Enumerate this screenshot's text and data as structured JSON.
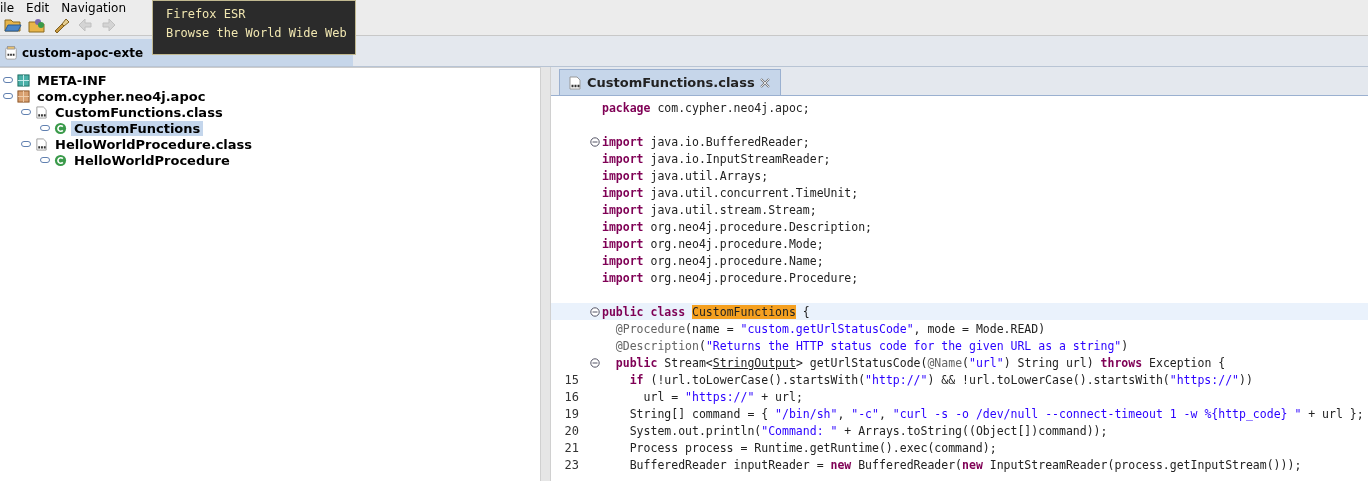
{
  "menu": [
    "ile",
    "Edit",
    "Navigation"
  ],
  "toolbar": [
    {
      "kind": "open"
    },
    {
      "kind": "open-type"
    },
    {
      "kind": "search"
    },
    {
      "kind": "back",
      "disabled": true
    },
    {
      "kind": "forward",
      "disabled": true
    }
  ],
  "tooltip": {
    "title": "Firefox ESR",
    "text": "Browse the World Wide Web"
  },
  "file_tab": {
    "label": "custom-apoc-exte"
  },
  "tree": [
    {
      "label": "META-INF",
      "kind": "folder",
      "selected": false
    },
    {
      "label": "com.cypher.neo4j.apoc",
      "kind": "package",
      "selected": false,
      "children": [
        {
          "label": "CustomFunctions.class",
          "kind": "classfile",
          "selected": false,
          "children": [
            {
              "label": "CustomFunctions",
              "kind": "class",
              "selected": true
            }
          ]
        },
        {
          "label": "HelloWorldProcedure.class",
          "kind": "classfile",
          "selected": false,
          "children": [
            {
              "label": "HelloWorldProcedure",
              "kind": "class",
              "selected": false
            }
          ]
        }
      ]
    }
  ],
  "editor_tab": {
    "label": "CustomFunctions.class",
    "selected": true
  },
  "code": [
    {
      "fold": false,
      "current": false,
      "tokens": [
        {
          "kind": "keyword",
          "text": "package"
        },
        {
          "kind": "plain",
          "text": " com.cypher.neo4j.apoc;"
        }
      ]
    },
    {
      "fold": false,
      "current": false
    },
    {
      "fold": true,
      "current": false,
      "tokens": [
        {
          "kind": "keyword",
          "text": "import"
        },
        {
          "kind": "plain",
          "text": " java.io.BufferedReader;"
        }
      ]
    },
    {
      "fold": false,
      "current": false,
      "tokens": [
        {
          "kind": "keyword",
          "text": "import"
        },
        {
          "kind": "plain",
          "text": " java.io.InputStreamReader;"
        }
      ]
    },
    {
      "fold": false,
      "current": false,
      "tokens": [
        {
          "kind": "keyword",
          "text": "import"
        },
        {
          "kind": "plain",
          "text": " java.util.Arrays;"
        }
      ]
    },
    {
      "fold": false,
      "current": false,
      "tokens": [
        {
          "kind": "keyword",
          "text": "import"
        },
        {
          "kind": "plain",
          "text": " java.util.concurrent.TimeUnit;"
        }
      ]
    },
    {
      "fold": false,
      "current": false,
      "tokens": [
        {
          "kind": "keyword",
          "text": "import"
        },
        {
          "kind": "plain",
          "text": " java.util.stream.Stream;"
        }
      ]
    },
    {
      "fold": false,
      "current": false,
      "tokens": [
        {
          "kind": "keyword",
          "text": "import"
        },
        {
          "kind": "plain",
          "text": " org.neo4j.procedure.Description;"
        }
      ]
    },
    {
      "fold": false,
      "current": false,
      "tokens": [
        {
          "kind": "keyword",
          "text": "import"
        },
        {
          "kind": "plain",
          "text": " org.neo4j.procedure.Mode;"
        }
      ]
    },
    {
      "fold": false,
      "current": false,
      "tokens": [
        {
          "kind": "keyword",
          "text": "import"
        },
        {
          "kind": "plain",
          "text": " org.neo4j.procedure.Name;"
        }
      ]
    },
    {
      "fold": false,
      "current": false,
      "tokens": [
        {
          "kind": "keyword",
          "text": "import"
        },
        {
          "kind": "plain",
          "text": " org.neo4j.procedure.Procedure;"
        }
      ]
    },
    {
      "fold": false,
      "current": false
    },
    {
      "fold": true,
      "current": true,
      "tokens": [
        {
          "kind": "keyword",
          "text": "public class "
        },
        {
          "kind": "highlight",
          "text": "CustomFunctions"
        },
        {
          "kind": "plain",
          "text": " {"
        }
      ]
    },
    {
      "fold": false,
      "current": false,
      "tokens": [
        {
          "kind": "annotation",
          "text": "  @Procedure"
        },
        {
          "kind": "plain",
          "text": "(name = "
        },
        {
          "kind": "string",
          "text": "\"custom.getUrlStatusCode\""
        },
        {
          "kind": "plain",
          "text": ", mode = Mode.READ)"
        }
      ]
    },
    {
      "fold": false,
      "current": false,
      "tokens": [
        {
          "kind": "annotation",
          "text": "  @Description"
        },
        {
          "kind": "plain",
          "text": "("
        },
        {
          "kind": "string",
          "text": "\"Returns the HTTP status code for the given URL as a string\""
        },
        {
          "kind": "plain",
          "text": ")"
        }
      ]
    },
    {
      "fold": true,
      "current": false,
      "tokens": [
        {
          "kind": "keyword",
          "text": "  public"
        },
        {
          "kind": "plain",
          "text": " Stream<"
        },
        {
          "kind": "link",
          "text": "StringOutput"
        },
        {
          "kind": "plain",
          "text": "> getUrlStatusCode("
        },
        {
          "kind": "annotation",
          "text": "@Name"
        },
        {
          "kind": "plain",
          "text": "("
        },
        {
          "kind": "string",
          "text": "\"url\""
        },
        {
          "kind": "plain",
          "text": ") String url) "
        },
        {
          "kind": "keyword",
          "text": "throws"
        },
        {
          "kind": "plain",
          "text": " Exception {"
        }
      ]
    },
    {
      "number": "15",
      "fold": false,
      "current": false,
      "tokens": [
        {
          "kind": "keyword",
          "text": "    if"
        },
        {
          "kind": "plain",
          "text": " (!url.toLowerCase().startsWith("
        },
        {
          "kind": "string",
          "text": "\"http://\""
        },
        {
          "kind": "plain",
          "text": ") && !url.toLowerCase().startsWith("
        },
        {
          "kind": "string",
          "text": "\"https://\""
        },
        {
          "kind": "plain",
          "text": "))"
        }
      ]
    },
    {
      "number": "16",
      "fold": false,
      "current": false,
      "tokens": [
        {
          "kind": "plain",
          "text": "      url = "
        },
        {
          "kind": "string",
          "text": "\"https://\""
        },
        {
          "kind": "plain",
          "text": " + url;"
        }
      ]
    },
    {
      "number": "19",
      "fold": false,
      "current": false,
      "tokens": [
        {
          "kind": "plain",
          "text": "    String[] command = { "
        },
        {
          "kind": "string",
          "text": "\"/bin/sh\""
        },
        {
          "kind": "plain",
          "text": ", "
        },
        {
          "kind": "string",
          "text": "\"-c\""
        },
        {
          "kind": "plain",
          "text": ", "
        },
        {
          "kind": "string",
          "text": "\"curl -s -o /dev/null --connect-timeout 1 -w %{http_code} \""
        },
        {
          "kind": "plain",
          "text": " + url };"
        }
      ]
    },
    {
      "number": "20",
      "fold": false,
      "current": false,
      "tokens": [
        {
          "kind": "plain",
          "text": "    System.out.println("
        },
        {
          "kind": "string",
          "text": "\"Command: \""
        },
        {
          "kind": "plain",
          "text": " + Arrays.toString((Object[])command));"
        }
      ]
    },
    {
      "number": "21",
      "fold": false,
      "current": false,
      "tokens": [
        {
          "kind": "plain",
          "text": "    Process process = Runtime.getRuntime().exec(command);"
        }
      ]
    },
    {
      "number": "23",
      "fold": false,
      "current": false,
      "tokens": [
        {
          "kind": "plain",
          "text": "    BufferedReader inputReader = "
        },
        {
          "kind": "keyword",
          "text": "new"
        },
        {
          "kind": "plain",
          "text": " BufferedReader("
        },
        {
          "kind": "keyword",
          "text": "new"
        },
        {
          "kind": "plain",
          "text": " InputStreamReader(process.getInputStream()));"
        }
      ]
    }
  ]
}
